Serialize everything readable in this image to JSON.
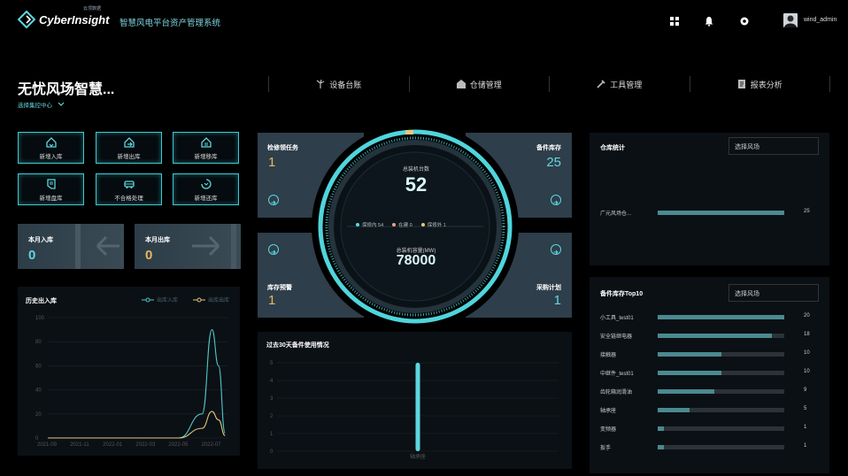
{
  "header": {
    "logo_text": "CyberInsight",
    "logo_sub": "云顶数据",
    "system_title": "智慧风电平台资产管理系统",
    "username": "wind_admin"
  },
  "page": {
    "title": "无忧风场智慧...",
    "center_select": "选择集控中心"
  },
  "nav": {
    "items": [
      {
        "label": "设备台账",
        "icon": "wind-turbine-icon"
      },
      {
        "label": "仓储管理",
        "icon": "warehouse-icon"
      },
      {
        "label": "工具管理",
        "icon": "tools-icon"
      },
      {
        "label": "报表分析",
        "icon": "report-icon"
      }
    ]
  },
  "quick_actions": [
    {
      "label": "新增入库"
    },
    {
      "label": "新增出库"
    },
    {
      "label": "新增移库"
    },
    {
      "label": "新增盘库"
    },
    {
      "label": "不合格处理"
    },
    {
      "label": "新增还库"
    }
  ],
  "monthly": {
    "in_label": "本月入库",
    "in_value": "0",
    "out_label": "本月出库",
    "out_value": "0"
  },
  "history_chart": {
    "title": "历史出入库",
    "legend_in": "出库入库",
    "legend_out": "出库出库",
    "accent_in": "#4fc7c9",
    "accent_out": "#e6c77a"
  },
  "center": {
    "task_label": "检修领任务",
    "task_value": "1",
    "spare_label": "备件库存",
    "spare_value": "25",
    "warning_label": "库存预警",
    "warning_value": "1",
    "plan_label": "采购计划",
    "plan_value": "1",
    "total_label": "总装机台数",
    "total_value": "52",
    "status1": "保修内 54",
    "status2": "在建 0",
    "status3": "保修外 1",
    "capacity_label": "总装机容量(MW)",
    "capacity_value": "78000"
  },
  "usage_chart": {
    "title": "过去30天备件使用情况",
    "category": "轴承座"
  },
  "warehouse": {
    "title": "仓库统计",
    "select_placeholder": "选择风场",
    "rows": [
      {
        "name": "广元风场仓...",
        "value": "25",
        "fraction": 1.0
      }
    ]
  },
  "top10": {
    "title": "备件库存Top10",
    "select_placeholder": "选择风场",
    "rows": [
      {
        "name": "小工具_test01",
        "value": "20",
        "fraction": 1.0
      },
      {
        "name": "安全链继电器",
        "value": "18",
        "fraction": 0.9
      },
      {
        "name": "接触器",
        "value": "10",
        "fraction": 0.5
      },
      {
        "name": "中继件_test01",
        "value": "10",
        "fraction": 0.5
      },
      {
        "name": "齿轮箱润滑油",
        "value": "9",
        "fraction": 0.45
      },
      {
        "name": "轴承座",
        "value": "5",
        "fraction": 0.25
      },
      {
        "name": "变频器",
        "value": "1",
        "fraction": 0.05
      },
      {
        "name": "扳手",
        "value": "1",
        "fraction": 0.05
      }
    ]
  },
  "chart_data": [
    {
      "type": "line",
      "title": "历史出入库",
      "x": [
        "2021-09",
        "2021-11",
        "2022-01",
        "2022-03",
        "2022-05",
        "2022-07"
      ],
      "ylim": [
        0,
        100
      ],
      "yticks": [
        0,
        20,
        40,
        60,
        80,
        100
      ],
      "series": [
        {
          "name": "出库入库",
          "points": [
            [
              0,
              0
            ],
            [
              1,
              0
            ],
            [
              2,
              0
            ],
            [
              3,
              0
            ],
            [
              4,
              0
            ],
            [
              4.7,
              20
            ],
            [
              5,
              90
            ],
            [
              5.2,
              60
            ],
            [
              5.4,
              4
            ]
          ]
        },
        {
          "name": "出库出库",
          "points": [
            [
              0,
              0
            ],
            [
              1,
              0
            ],
            [
              2,
              0
            ],
            [
              3,
              0
            ],
            [
              4,
              0
            ],
            [
              4.7,
              8
            ],
            [
              5,
              22
            ],
            [
              5.2,
              15
            ],
            [
              5.4,
              2
            ]
          ]
        }
      ],
      "grid": true,
      "legend": "top-right"
    },
    {
      "type": "bar",
      "title": "过去30天备件使用情况",
      "categories": [
        "轴承座"
      ],
      "values": [
        5
      ],
      "ylim": [
        0,
        5
      ],
      "yticks": [
        0,
        1,
        2,
        3,
        4,
        5
      ],
      "grid": true
    }
  ]
}
